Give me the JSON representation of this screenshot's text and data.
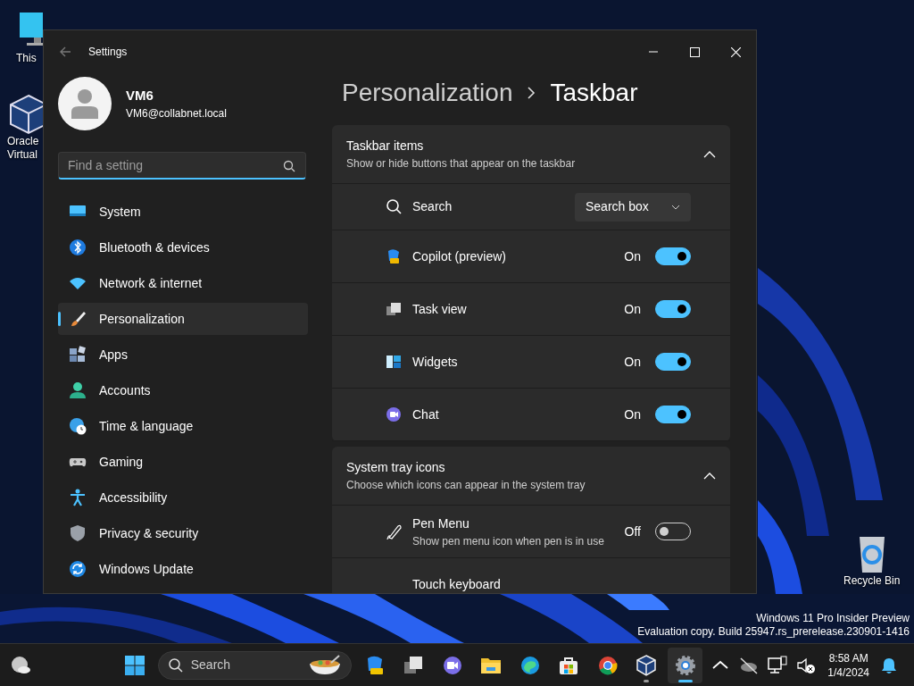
{
  "desktop_icons": [
    {
      "lines": [
        "This"
      ]
    },
    {
      "lines": [
        "Oracle",
        "Virtual"
      ]
    },
    {
      "lines": [
        "Recycle Bin"
      ]
    }
  ],
  "window": {
    "title": "Settings",
    "user": {
      "name": "VM6",
      "email": "VM6@collabnet.local"
    },
    "search": {
      "placeholder": "Find a setting"
    },
    "nav": [
      {
        "label": "System",
        "selected": false
      },
      {
        "label": "Bluetooth & devices",
        "selected": false
      },
      {
        "label": "Network & internet",
        "selected": false
      },
      {
        "label": "Personalization",
        "selected": true
      },
      {
        "label": "Apps",
        "selected": false
      },
      {
        "label": "Accounts",
        "selected": false
      },
      {
        "label": "Time & language",
        "selected": false
      },
      {
        "label": "Gaming",
        "selected": false
      },
      {
        "label": "Accessibility",
        "selected": false
      },
      {
        "label": "Privacy & security",
        "selected": false
      },
      {
        "label": "Windows Update",
        "selected": false
      }
    ],
    "breadcrumb": [
      "Personalization",
      "Taskbar"
    ],
    "sections": [
      {
        "title": "Taskbar items",
        "subtitle": "Show or hide buttons that appear on the taskbar",
        "expanded": true,
        "rows": [
          {
            "kind": "dropdown",
            "label": "Search",
            "value": "Search box"
          },
          {
            "kind": "toggle",
            "label": "Copilot (preview)",
            "state_text": "On",
            "on": true
          },
          {
            "kind": "toggle",
            "label": "Task view",
            "state_text": "On",
            "on": true
          },
          {
            "kind": "toggle",
            "label": "Widgets",
            "state_text": "On",
            "on": true
          },
          {
            "kind": "toggle",
            "label": "Chat",
            "state_text": "On",
            "on": true
          }
        ]
      },
      {
        "title": "System tray icons",
        "subtitle": "Choose which icons can appear in the system tray",
        "expanded": true,
        "rows": [
          {
            "kind": "toggle",
            "label": "Pen Menu",
            "description": "Show pen menu icon when pen is in use",
            "state_text": "Off",
            "on": false
          },
          {
            "kind": "plain",
            "label": "Touch keyboard"
          }
        ]
      }
    ]
  },
  "watermark": [
    "Windows 11 Pro Insider Preview",
    "Evaluation copy. Build 25947.rs_prerelease.230901-1416"
  ],
  "taskbar": {
    "search": {
      "placeholder": "Search"
    },
    "apps": [
      {
        "running": false,
        "active": false
      },
      {
        "running": false,
        "active": false
      },
      {
        "running": false,
        "active": false
      },
      {
        "running": false,
        "active": false
      },
      {
        "running": false,
        "active": false
      },
      {
        "running": false,
        "active": false
      },
      {
        "running": false,
        "active": false
      },
      {
        "running": true,
        "active": false
      },
      {
        "running": true,
        "active": true
      }
    ],
    "clock": {
      "time": "8:58 AM",
      "date": "1/4/2024"
    }
  }
}
